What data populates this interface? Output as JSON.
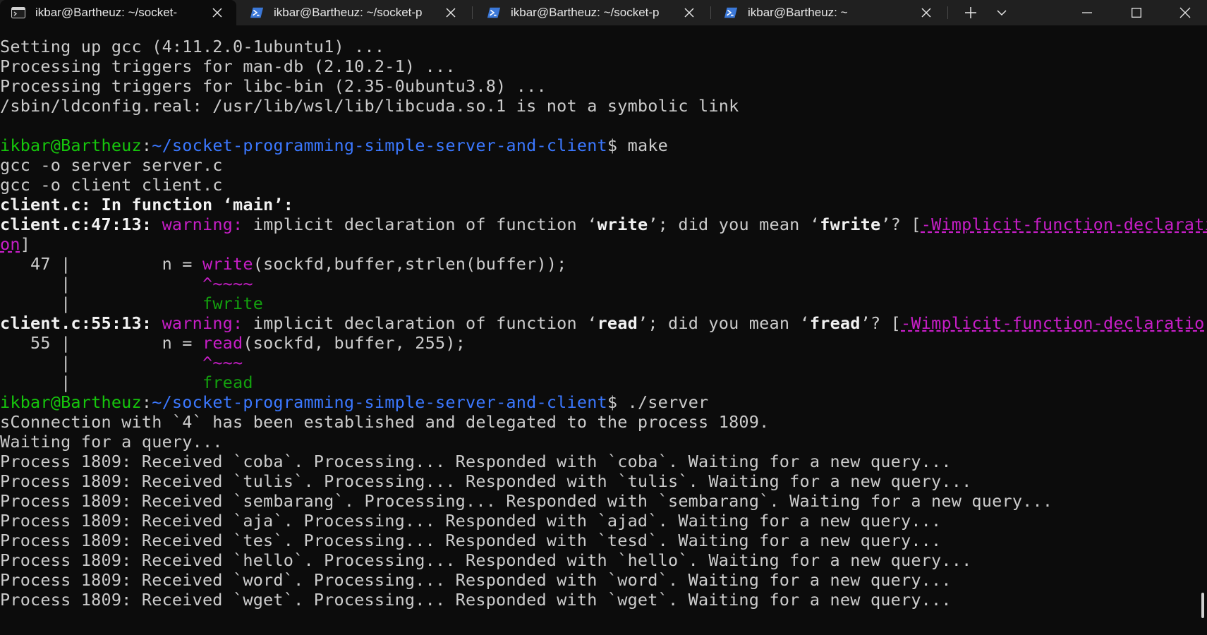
{
  "tabs": [
    {
      "label": "ikbar@Bartheuz: ~/socket-",
      "icon": "linux-terminal-icon",
      "active": true
    },
    {
      "label": "ikbar@Bartheuz: ~/socket-p",
      "icon": "powershell-icon",
      "active": false
    },
    {
      "label": "ikbar@Bartheuz: ~/socket-p",
      "icon": "powershell-icon",
      "active": false
    },
    {
      "label": "ikbar@Bartheuz: ~",
      "icon": "powershell-icon",
      "active": false
    }
  ],
  "window_controls": {
    "new_tab": "+",
    "dropdown": "chevron-down-icon",
    "minimize": "minimize-icon",
    "maximize": "maximize-icon",
    "close": "close-icon"
  },
  "colors": {
    "prompt_user": "#16c60c",
    "prompt_path": "#3b78ff",
    "warning": "#c71ec7",
    "fixit": "#13a10e",
    "text": "#cccccc",
    "background": "#0c0c0c"
  },
  "terminal": {
    "lines": [
      "Setting up gcc (4:11.2.0-1ubuntu1) ...",
      "Processing triggers for man-db (2.10.2-1) ...",
      "Processing triggers for libc-bin (2.35-0ubuntu3.8) ...",
      "/sbin/ldconfig.real: /usr/lib/wsl/lib/libcuda.so.1 is not a symbolic link"
    ],
    "prompt": {
      "user": "ikbar@Bartheuz",
      "sep": ":",
      "path": "~/socket-programming-simple-server-and-client",
      "dollar": "$ "
    },
    "cmd_make": "make",
    "gcc_server": "gcc -o server server.c",
    "gcc_client": "gcc -o client client.c",
    "in_function_prefix": "client.c: In function ‘",
    "in_function_name": "main",
    "in_function_suffix": "’:",
    "warn1": {
      "loc": "client.c:47:13: ",
      "label": "warning:",
      "msg1": " implicit declaration of function ‘",
      "fn": "write",
      "msg2": "’; did you mean ‘",
      "suggest": "fwrite",
      "msg3": "’? [",
      "flag1": "-Wimplicit-function-declarati",
      "flag2": "on",
      "close": "]",
      "gutter": "   47 | ",
      "code_pre": "        n = ",
      "code_fn": "write",
      "code_post": "(sockfd,buffer,strlen(buffer));",
      "caret_pre": "      |             ",
      "caret": "^~~~~",
      "fix_pre": "      |             ",
      "fix": "fwrite"
    },
    "warn2": {
      "loc": "client.c:55:13: ",
      "label": "warning:",
      "msg1": " implicit declaration of function ‘",
      "fn": "read",
      "msg2": "’; did you mean ‘",
      "suggest": "fread",
      "msg3": "’? [",
      "flag": "-Wimplicit-function-declaratio",
      "close": "]",
      "gutter": "   55 | ",
      "code_pre": "        n = ",
      "code_fn": "read",
      "code_post": "(sockfd, buffer, 255);",
      "caret_pre": "      |             ",
      "caret": "^~~~",
      "fix_pre": "      |             ",
      "fix": "fread"
    },
    "cmd_server": "./server",
    "server_output": [
      "sConnection with `4` has been established and delegated to the process 1809.",
      "Waiting for a query...",
      "Process 1809: Received `coba`. Processing... Responded with `coba`. Waiting for a new query...",
      "Process 1809: Received `tulis`. Processing... Responded with `tulis`. Waiting for a new query...",
      "Process 1809: Received `sembarang`. Processing... Responded with `sembarang`. Waiting for a new query...",
      "Process 1809: Received `aja`. Processing... Responded with `ajad`. Waiting for a new query...",
      "Process 1809: Received `tes`. Processing... Responded with `tesd`. Waiting for a new query...",
      "Process 1809: Received `hello`. Processing... Responded with `hello`. Waiting for a new query...",
      "Process 1809: Received `word`. Processing... Responded with `word`. Waiting for a new query...",
      "Process 1809: Received `wget`. Processing... Responded with `wget`. Waiting for a new query..."
    ]
  }
}
